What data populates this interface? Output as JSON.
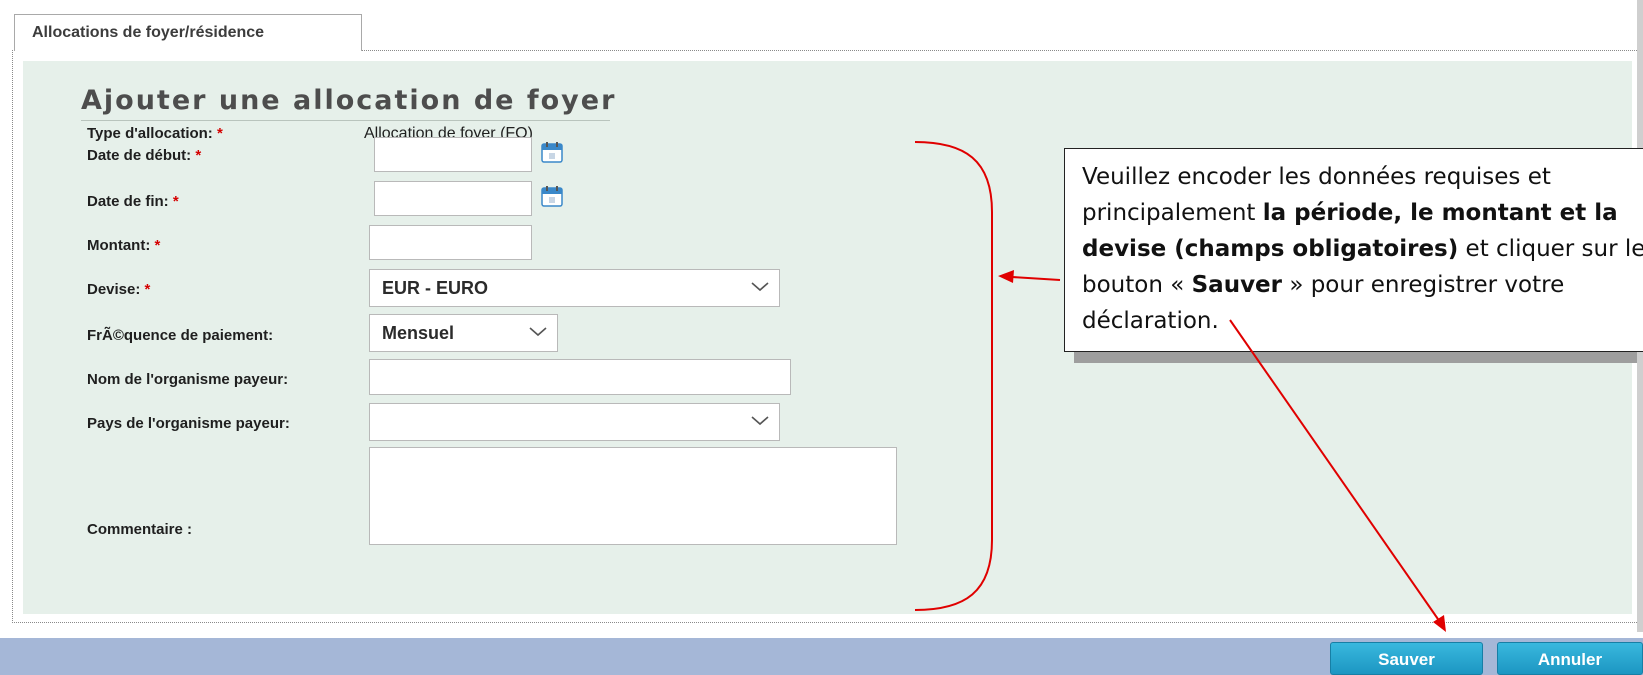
{
  "tab": {
    "label": "Allocations de foyer/résidence"
  },
  "form": {
    "title": "Ajouter une allocation de foyer",
    "required_mark": "*",
    "type_allocation": {
      "label": "Type d'allocation:",
      "value": "Allocation de foyer (FO)"
    },
    "date_debut": {
      "label": "Date de début:",
      "value": ""
    },
    "date_fin": {
      "label": "Date de fin:",
      "value": ""
    },
    "montant": {
      "label": "Montant:",
      "value": ""
    },
    "devise": {
      "label": "Devise:",
      "selected": "EUR - EURO"
    },
    "frequence": {
      "label": "FrÃ©quence de paiement:",
      "selected": "Mensuel"
    },
    "organisme_nom": {
      "label": "Nom de l'organisme payeur:",
      "value": ""
    },
    "organisme_pays": {
      "label": "Pays de l'organisme payeur:",
      "selected": ""
    },
    "commentaire": {
      "label": "Commentaire :",
      "value": ""
    }
  },
  "buttons": {
    "save": "Sauver",
    "cancel": "Annuler"
  },
  "callout": {
    "line1": "Veuillez encoder les données requises et",
    "line2_normal": "principalement ",
    "line2_bold": "la période, le montant et la",
    "line3_bold": "devise (champs obligatoires)",
    "line3_normal": " et cliquer sur le",
    "line4_pre": "bouton « ",
    "line4_bold": "Sauver",
    "line4_post": " » pour enregistrer votre",
    "line5": "déclaration."
  },
  "colors": {
    "panel_bg": "#e6f0ea",
    "required": "#d40000",
    "button": "#1c96c2",
    "bottom_bar": "#a5b7d7",
    "annotation": "#e00000"
  },
  "icons": {
    "calendar": "calendar-icon",
    "dropdown": "chevron-down-icon"
  }
}
